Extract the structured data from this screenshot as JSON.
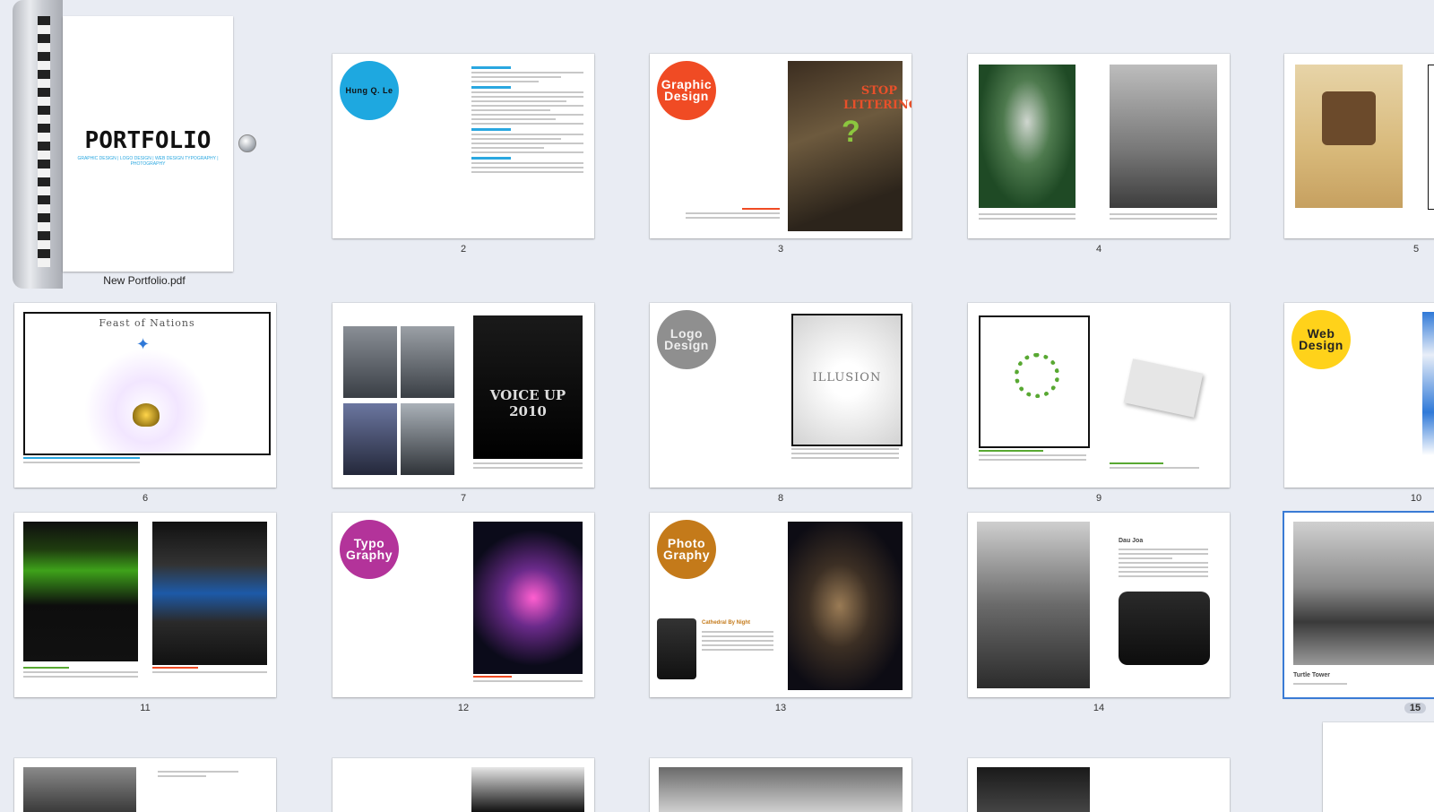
{
  "document": {
    "file_name": "New Portfolio.pdf",
    "cover_title": "PORTFOLIO",
    "cover_subtitle": "GRAPHIC DESIGN | LOGO DESIGN | WEB DESIGN TYPOGRAPHY | PHOTOGRAPHY",
    "selected_page": 15
  },
  "pages": {
    "p2": {
      "number": "2",
      "name_circle": "Hung Q. Le",
      "headings": [
        "Skills",
        "Experience",
        "Education",
        "Interests"
      ]
    },
    "p3": {
      "number": "3",
      "circle": "Graphic Design",
      "poster_text": "STOP LITTERING"
    },
    "p4": {
      "number": "4"
    },
    "p5": {
      "number": "5"
    },
    "p6": {
      "number": "6",
      "banner": "Feast of Nations"
    },
    "p7": {
      "number": "7",
      "poster": "VOICE UP 2010"
    },
    "p8": {
      "number": "8",
      "circle": "Logo Design",
      "logo": "ILLUSION"
    },
    "p9": {
      "number": "9"
    },
    "p10": {
      "number": "10",
      "circle": "Web Design"
    },
    "p11": {
      "number": "11"
    },
    "p12": {
      "number": "12",
      "circle": "Typo Graphy"
    },
    "p13": {
      "number": "13",
      "circle": "Photo Graphy",
      "caption": "Cathedral By Night"
    },
    "p14": {
      "number": "14",
      "caption": "Dau Joa"
    },
    "p15": {
      "number": "15",
      "caption": "Turtle Tower"
    }
  },
  "colors": {
    "background": "#e9ecf3",
    "blue": "#1ea8e0",
    "orange": "#f04b24",
    "gray": "#8f8f8f",
    "yellow": "#ffd21a",
    "purple": "#b3339a",
    "amber": "#c47a1a",
    "selection": "#3a7bd5"
  }
}
